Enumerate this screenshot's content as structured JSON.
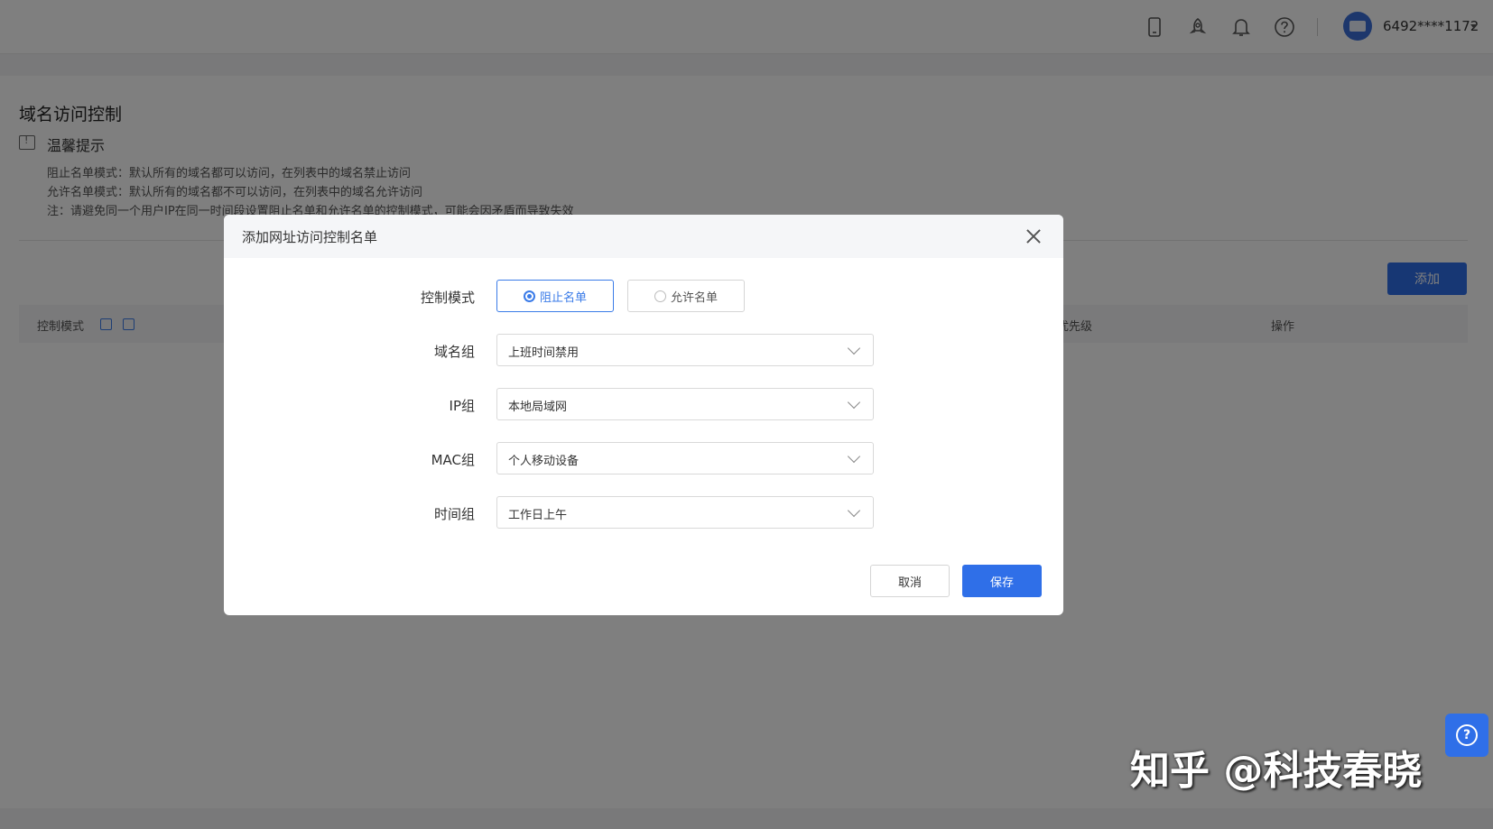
{
  "topbar": {
    "icons": [
      "phone-icon",
      "rocket-icon",
      "bell-icon",
      "help-icon"
    ],
    "user_name": "6492****1172"
  },
  "page": {
    "title": "域名访问控制",
    "tip_title": "温馨提示",
    "tips": [
      "阻止名单模式：默认所有的域名都可以访问，在列表中的域名禁止访问",
      "允许名单模式：默认所有的域名都不可以访问，在列表中的域名允许访问",
      "注：请避免同一个用户IP在同一时间段设置阻止名单和允许名单的控制模式，可能会因矛盾而导致失效"
    ],
    "add_label": "添加",
    "table_headers": {
      "mode": "控制模式",
      "priority": "优先级",
      "action": "操作"
    }
  },
  "modal": {
    "title": "添加网址访问控制名单",
    "mode_label": "控制模式",
    "mode_options": [
      "阻止名单",
      "允许名单"
    ],
    "mode_selected": "阻止名单",
    "domain_group_label": "域名组",
    "domain_group_value": "上班时间禁用",
    "ip_group_label": "IP组",
    "ip_group_value": "本地局域网",
    "mac_group_label": "MAC组",
    "mac_group_value": "个人移动设备",
    "time_group_label": "时间组",
    "time_group_value": "工作日上午",
    "cancel_label": "取消",
    "save_label": "保存"
  },
  "watermark": "知乎 @科技春晓",
  "colors": {
    "accent": "#2f6fe8",
    "overlay": "rgba(0,0,0,0.5)"
  }
}
